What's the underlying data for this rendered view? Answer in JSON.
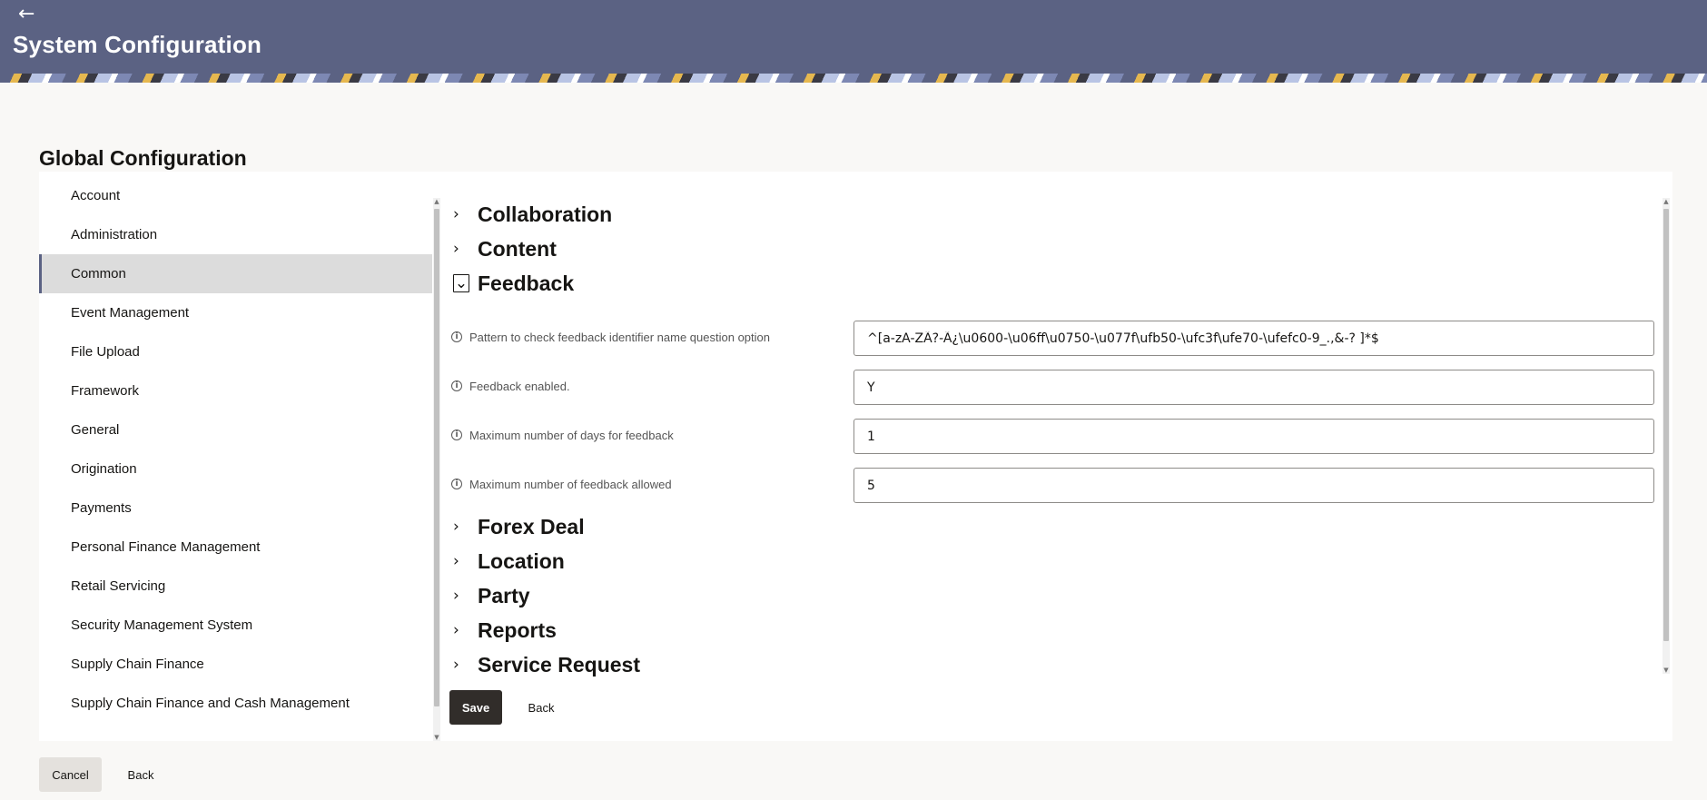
{
  "header": {
    "back_icon": "left-arrow-icon",
    "title": "System Configuration"
  },
  "page": {
    "title": "Global Configuration"
  },
  "sidebar": {
    "active": "Common",
    "items": [
      {
        "label": "Account"
      },
      {
        "label": "Administration"
      },
      {
        "label": "Common"
      },
      {
        "label": "Event Management"
      },
      {
        "label": "File Upload"
      },
      {
        "label": "Framework"
      },
      {
        "label": "General"
      },
      {
        "label": "Origination"
      },
      {
        "label": "Payments"
      },
      {
        "label": "Personal Finance Management"
      },
      {
        "label": "Retail Servicing"
      },
      {
        "label": "Security Management System"
      },
      {
        "label": "Supply Chain Finance"
      },
      {
        "label": "Supply Chain Finance and Cash Management"
      }
    ]
  },
  "sections": {
    "collapsed_icon": "chevron-right-icon",
    "expanded_icon": "chevron-down-icon",
    "items": [
      {
        "label": "Collaboration",
        "expanded": false
      },
      {
        "label": "Content",
        "expanded": false
      },
      {
        "label": "Feedback",
        "expanded": true
      },
      {
        "label": "Forex Deal",
        "expanded": false
      },
      {
        "label": "Location",
        "expanded": false
      },
      {
        "label": "Party",
        "expanded": false
      },
      {
        "label": "Reports",
        "expanded": false
      },
      {
        "label": "Service Request",
        "expanded": false
      }
    ]
  },
  "feedback": {
    "info_icon": "info-icon",
    "fields": [
      {
        "label": "Pattern to check feedback identifier name question option",
        "value": "^[a-zA-ZÃ?-Ã¿\\u0600-\\u06ff\\u0750-\\u077f\\ufb50-\\ufc3f\\ufe70-\\ufefc0-9_.,&-? ]*$"
      },
      {
        "label": "Feedback enabled.",
        "value": "Y"
      },
      {
        "label": "Maximum number of days for feedback",
        "value": "1"
      },
      {
        "label": "Maximum number of feedback allowed",
        "value": "5"
      }
    ]
  },
  "actions": {
    "save_label": "Save",
    "back_label": "Back"
  },
  "footer": {
    "cancel_label": "Cancel",
    "back_label": "Back"
  },
  "colors": {
    "header_bg": "#5b6283",
    "primary_button": "#312d2a",
    "active_nav_bg": "#dcdcdc"
  }
}
